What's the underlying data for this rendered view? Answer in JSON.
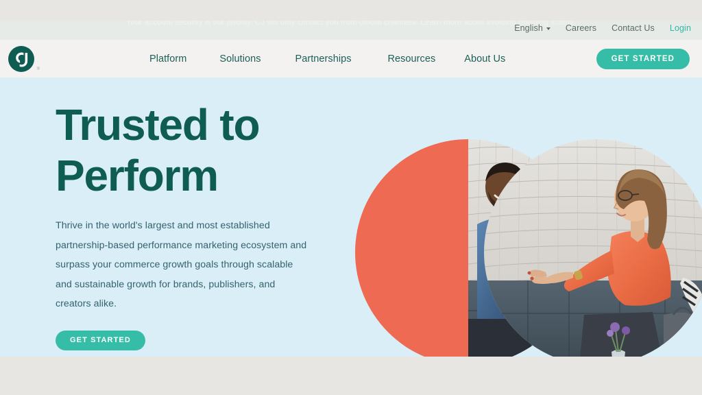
{
  "announcement": {
    "text": "Your account security is our priority. CJ will only contact you from official channels. Learn more about avoiding phishing scams."
  },
  "utility_nav": {
    "language": "English",
    "items": [
      {
        "label": "Careers",
        "name": "careers"
      },
      {
        "label": "Contact Us",
        "name": "contact-us"
      }
    ],
    "login": "Login"
  },
  "header": {
    "logo_alt": "CJ",
    "logo_tm": "®",
    "nav": [
      {
        "label": "Platform"
      },
      {
        "label": "Solutions"
      },
      {
        "label": "Partnerships"
      },
      {
        "label": "Resources"
      },
      {
        "label": "About Us"
      }
    ],
    "cta": "GET STARTED"
  },
  "hero": {
    "title_line1": "Trusted to",
    "title_line2": "Perform",
    "subtitle": "Thrive in the world's largest and most established partnership-based performance marketing ecosystem and surpass your commerce growth goals through scalable and sustainable growth for brands, publishers, and creators alike.",
    "cta": "GET STARTED"
  },
  "colors": {
    "brand_green": "#0f5c53",
    "nav_green": "#1c5f56",
    "teal_accent": "#36bda8",
    "login_teal": "#2fb8a0",
    "coral": "#ee6a52",
    "hero_bg": "#d9eef7",
    "header_bg": "#f4f2f0",
    "announcement_bg": "#e7ebe8",
    "page_bg": "#e8e6e3",
    "body_text": "#34626e"
  }
}
